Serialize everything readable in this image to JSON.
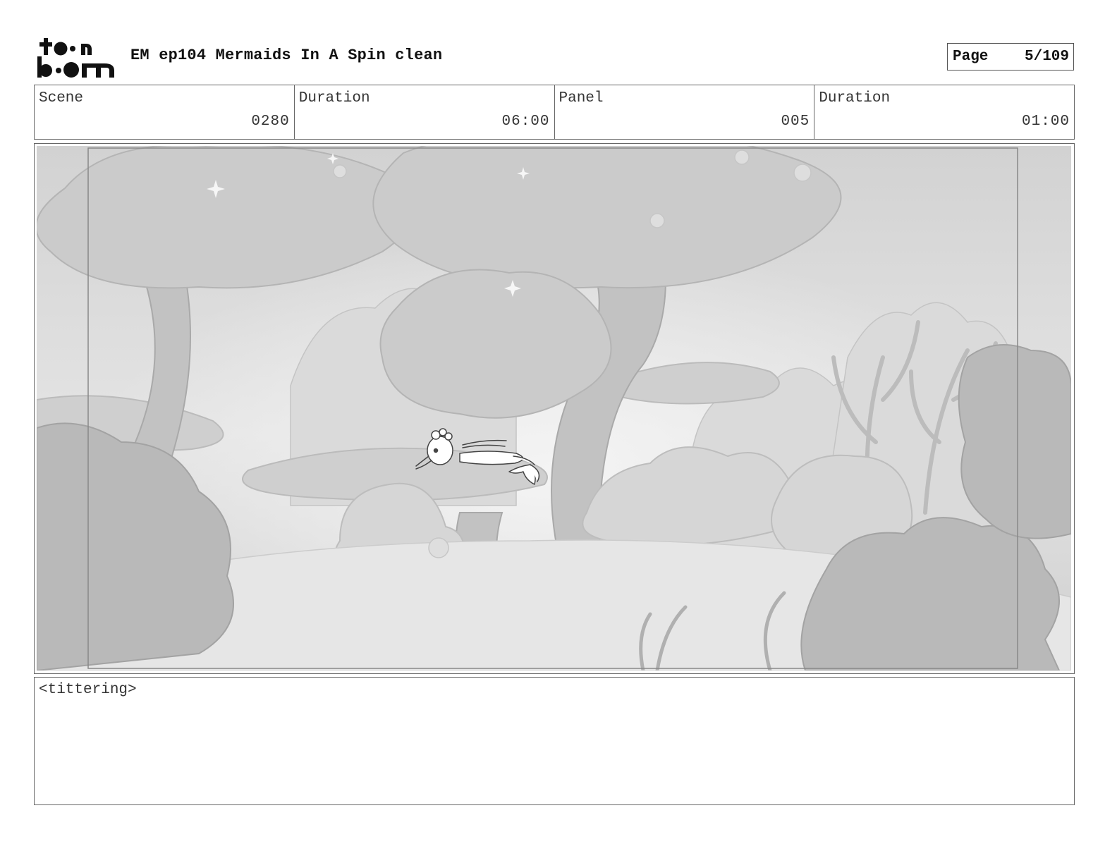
{
  "header": {
    "logo_text": "toon boom",
    "title": "EM ep104 Mermaids In A Spin clean",
    "page_label": "Page",
    "page_value": "5/109"
  },
  "info": {
    "scene_label": "Scene",
    "scene_value": "0280",
    "scene_duration_label": "Duration",
    "scene_duration_value": "06:00",
    "panel_label": "Panel",
    "panel_value": "005",
    "panel_duration_label": "Duration",
    "panel_duration_value": "01:00"
  },
  "panel": {
    "image_subject": "underwater-coral-reef-with-mermaid"
  },
  "dialogue": {
    "text": "<tittering>"
  }
}
